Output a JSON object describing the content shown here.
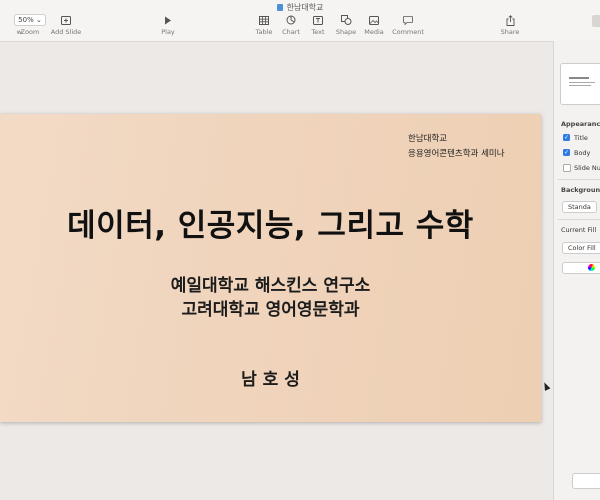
{
  "window": {
    "title": "한남대학교"
  },
  "toolbar": {
    "view_label": "w",
    "zoom_value": "50%",
    "zoom_label": "Zoom",
    "add_slide_label": "Add Slide",
    "play_label": "Play",
    "table_label": "Table",
    "chart_label": "Chart",
    "text_label": "Text",
    "shape_label": "Shape",
    "media_label": "Media",
    "comment_label": "Comment",
    "share_label": "Share"
  },
  "slide": {
    "university": "한남대학교",
    "department": "응용영어콘텐츠학과 세미나",
    "title": "데이터, 인공지능, 그리고 수학",
    "subtitle_1": "예일대학교 해스킨스 연구소",
    "subtitle_2": "고려대학교 영어영문학과",
    "author": "남 호 성"
  },
  "inspector": {
    "appearance_heading": "Appearance",
    "title_checkbox": {
      "label": "Title",
      "checked": true
    },
    "body_checkbox": {
      "label": "Body",
      "checked": true
    },
    "slide_number_checkbox": {
      "label": "Slide Nu",
      "checked": false
    },
    "background_heading": "Background",
    "background_button": "Standa",
    "current_fill_label": "Current Fill",
    "color_fill_option": "Color Fill"
  },
  "colors": {
    "slide_bg_start": "#f2dbc6",
    "slide_bg_end": "#edcfb3",
    "accent": "#2f7ae5"
  }
}
